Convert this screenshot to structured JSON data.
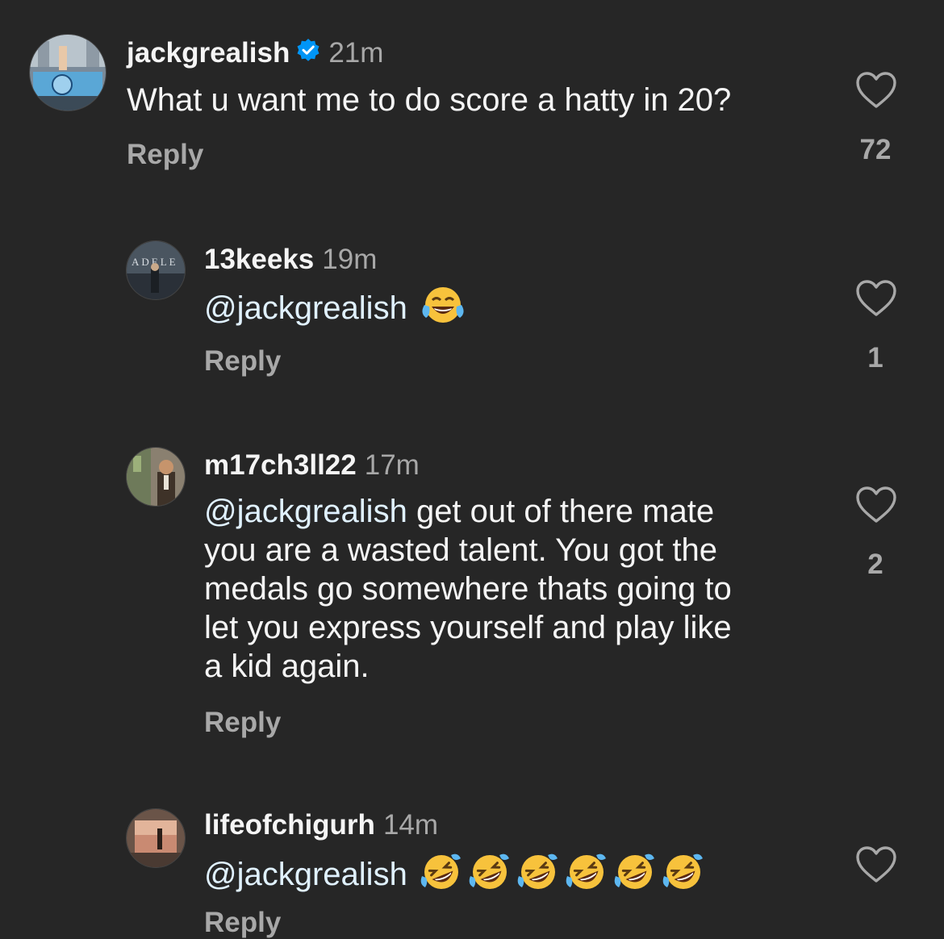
{
  "comments": [
    {
      "username": "jackgrealish",
      "verified": true,
      "time": "21m",
      "text": "What u want me to do score a hatty in 20?",
      "reply_label": "Reply",
      "likes": "72",
      "avatar": "city-parade-photo-avatar"
    },
    {
      "username": "13keeks",
      "time": "19m",
      "mention": "@jackgrealish",
      "text": "",
      "emojis": [
        "tears-of-joy-emoji"
      ],
      "reply_label": "Reply",
      "likes": "1",
      "avatar": "adele-concert-photo-avatar"
    },
    {
      "username": "m17ch3ll22",
      "time": "17m",
      "mention": "@jackgrealish",
      "text_lines": [
        " get out of there mate",
        "you are a wasted talent. You got the",
        "medals go somewhere thats going to",
        "let you express yourself and play like",
        "a kid again."
      ],
      "reply_label": "Reply",
      "likes": "2",
      "avatar": "man-in-suit-photo-avatar"
    },
    {
      "username": "lifeofchigurh",
      "time": "14m",
      "mention": "@jackgrealish",
      "emojis": [
        "rolling-on-floor-laughing-emoji",
        "rolling-on-floor-laughing-emoji",
        "rolling-on-floor-laughing-emoji",
        "rolling-on-floor-laughing-emoji",
        "rolling-on-floor-laughing-emoji",
        "rolling-on-floor-laughing-emoji"
      ],
      "reply_label": "Reply",
      "avatar": "sunset-window-photo-avatar"
    }
  ],
  "colors": {
    "background": "#262626",
    "text": "#f5f5f5",
    "secondary": "#a8a8a8",
    "verified": "#0095f6"
  }
}
